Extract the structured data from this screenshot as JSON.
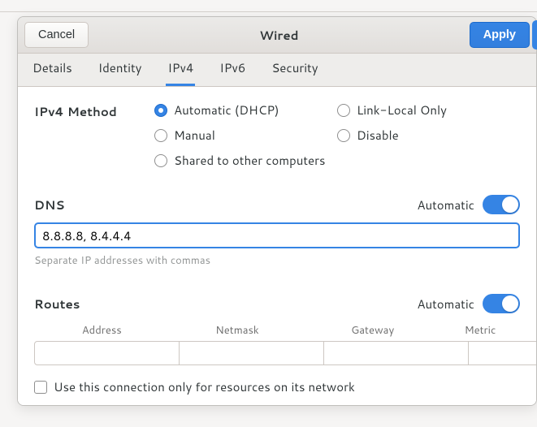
{
  "titlebar": {
    "cancel": "Cancel",
    "title": "Wired",
    "apply": "Apply"
  },
  "tabs": {
    "details": "Details",
    "identity": "Identity",
    "ipv4": "IPv4",
    "ipv6": "IPv6",
    "security": "Security"
  },
  "method": {
    "label": "IPv4 Method",
    "auto": "Automatic (DHCP)",
    "linklocal": "Link-Local Only",
    "manual": "Manual",
    "disable": "Disable",
    "shared": "Shared to other computers"
  },
  "dns": {
    "title": "DNS",
    "auto_label": "Automatic",
    "value": "8.8.8.8, 8.4.4.4",
    "hint": "Separate IP addresses with commas"
  },
  "routes": {
    "title": "Routes",
    "auto_label": "Automatic",
    "headers": {
      "address": "Address",
      "netmask": "Netmask",
      "gateway": "Gateway",
      "metric": "Metric"
    }
  },
  "only_resources": "Use this connection only for resources on its network"
}
